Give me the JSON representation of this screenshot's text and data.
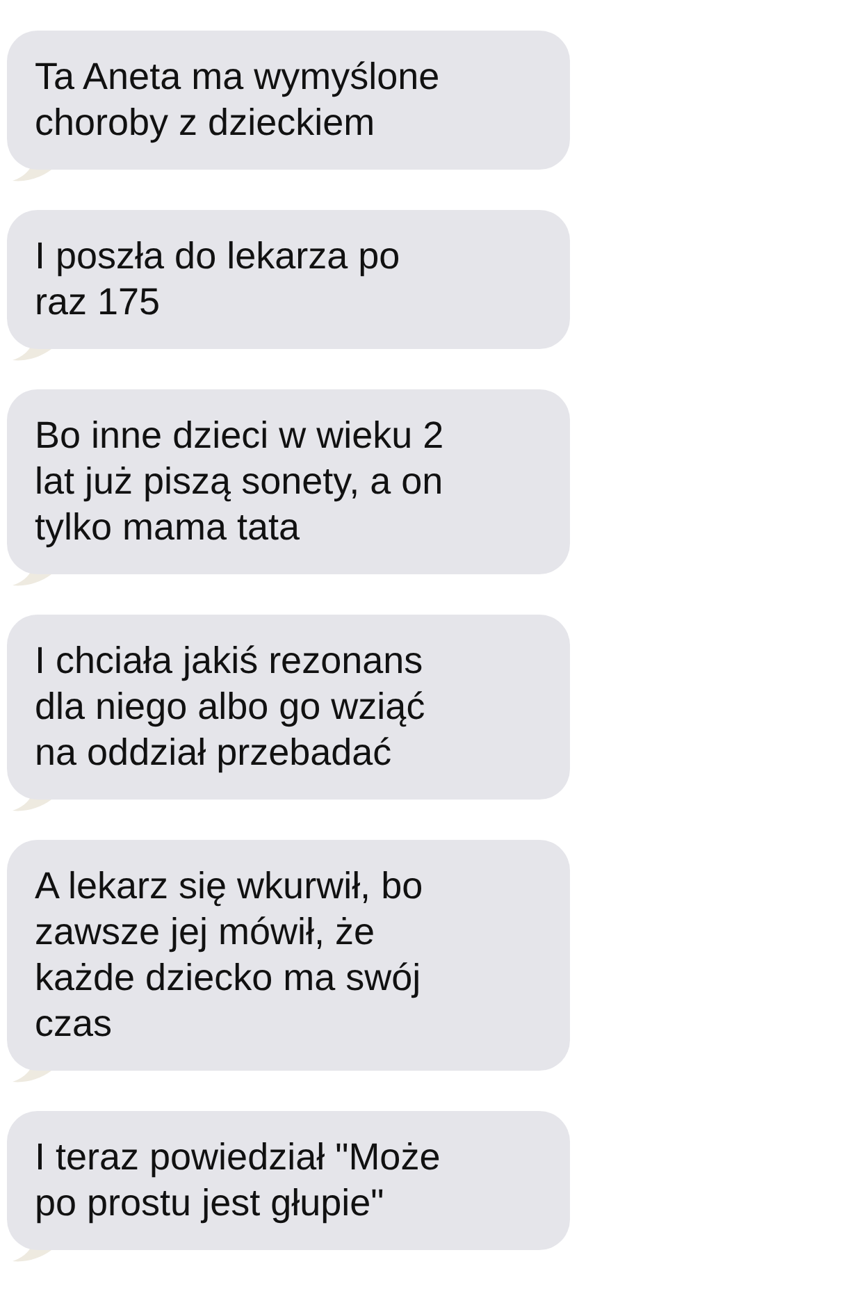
{
  "messages": [
    {
      "text": "Ta Aneta ma wymyślone\nchoroby z dzieckiem"
    },
    {
      "text": "I poszła do lekarza po\nraz 175"
    },
    {
      "text": "Bo inne dzieci w wieku 2\nlat już piszą sonety, a on\ntylko mama tata"
    },
    {
      "text": "I chciała jakiś rezonans\ndla niego albo go wziąć\nna oddział przebadać"
    },
    {
      "text": "A lekarz się wkurwił, bo\nzawsze jej mówił, że\nkażde dziecko ma swój\nczas"
    },
    {
      "text": "I teraz powiedział \"Może\npo prostu jest głupie\""
    }
  ]
}
